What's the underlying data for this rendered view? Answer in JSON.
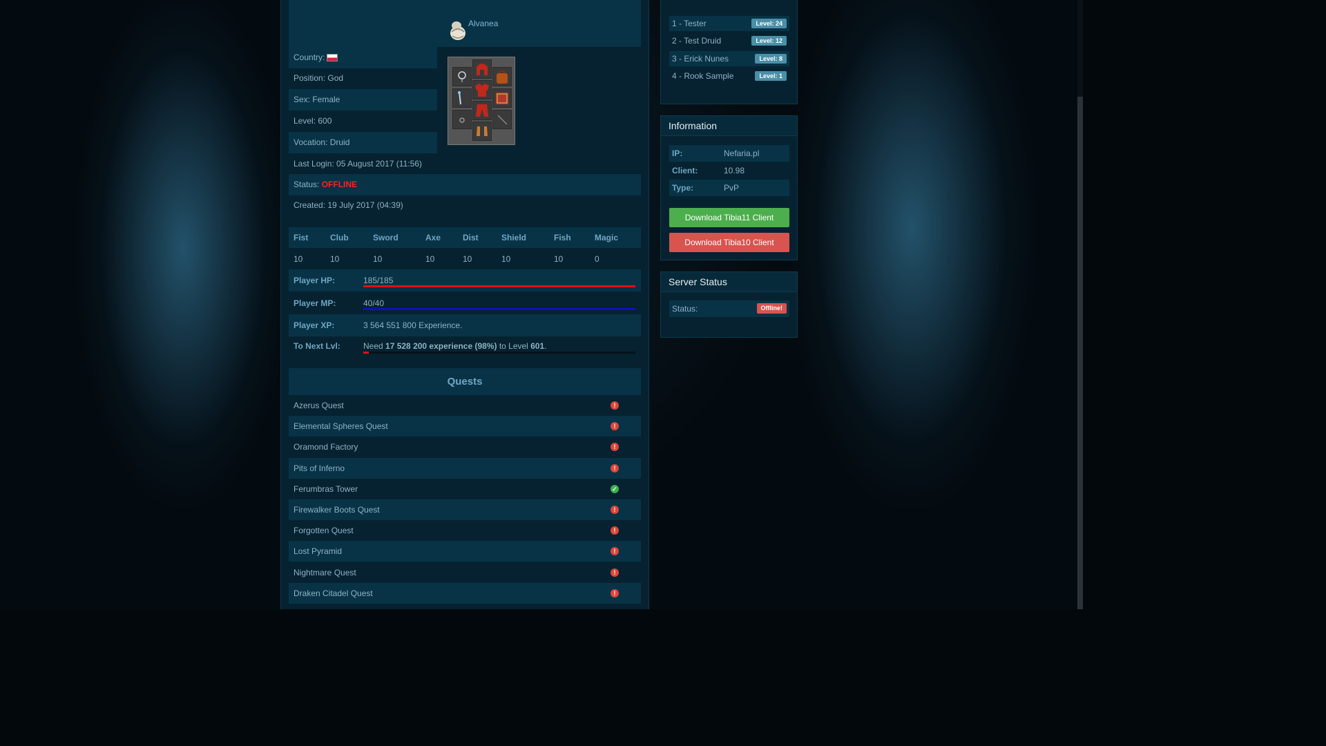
{
  "character": {
    "name": "Alvanea",
    "country_label": "Country:",
    "position": "Position: God",
    "sex": "Sex: Female",
    "level": "Level: 600",
    "vocation": "Vocation: Druid",
    "last_login": "Last Login: 05 August 2017 (11:56)",
    "status_label": "Status:",
    "status_value": "OFFLINE",
    "created": "Created: 19 July 2017 (04:39)"
  },
  "skills": {
    "headers": [
      "Fist",
      "Club",
      "Sword",
      "Axe",
      "Dist",
      "Shield",
      "Fish",
      "Magic"
    ],
    "values": [
      "10",
      "10",
      "10",
      "10",
      "10",
      "10",
      "10",
      "0"
    ]
  },
  "stats": {
    "hp_label": "Player HP:",
    "hp_value": "185/185",
    "hp_fraction": 1.0,
    "mp_label": "Player MP:",
    "mp_value": "40/40",
    "mp_fraction": 1.0,
    "xp_label": "Player XP:",
    "xp_value": "3 564 551 800 Experience.",
    "next_label": "To Next Lvl:",
    "next_pre": "Need ",
    "next_amount": "17 528 200 experience (98%)",
    "next_mid": " to Level ",
    "next_level": "601",
    "next_end": ".",
    "next_fraction": 0.02
  },
  "quests": {
    "title": "Quests",
    "items": [
      {
        "name": "Azerus Quest",
        "done": false
      },
      {
        "name": "Elemental Spheres Quest",
        "done": false
      },
      {
        "name": "Oramond Factory",
        "done": false
      },
      {
        "name": "Pits of Inferno",
        "done": false
      },
      {
        "name": "Ferumbras Tower",
        "done": true
      },
      {
        "name": "Firewalker Boots Quest",
        "done": false
      },
      {
        "name": "Forgotten Quest",
        "done": false
      },
      {
        "name": "Lost Pyramid",
        "done": false
      },
      {
        "name": "Nightmare Quest",
        "done": false
      },
      {
        "name": "Draken Citadel Quest",
        "done": false
      }
    ]
  },
  "top_players": [
    {
      "label": "1 - Tester",
      "level": "Level: 24"
    },
    {
      "label": "2 - Test Druid",
      "level": "Level: 12"
    },
    {
      "label": "3 - Erick Nunes",
      "level": "Level: 8"
    },
    {
      "label": "4 - Rook Sample",
      "level": "Level: 1"
    }
  ],
  "information": {
    "title": "Information",
    "ip_label": "IP:",
    "ip_value": "Nefaria.pl",
    "client_label": "Client:",
    "client_value": "10.98",
    "type_label": "Type:",
    "type_value": "PvP",
    "download_tibia11": "Download Tibia11 Client",
    "download_tibia10": "Download Tibia10 Client"
  },
  "server_status": {
    "title": "Server Status",
    "status_label": "Status:",
    "status_value": "Offline!"
  },
  "colors": {
    "panel": "#062230",
    "panel_alt": "#083346",
    "hp_bar": "#e01010",
    "mp_bar": "#1010c8",
    "offline": "#ff2020"
  }
}
